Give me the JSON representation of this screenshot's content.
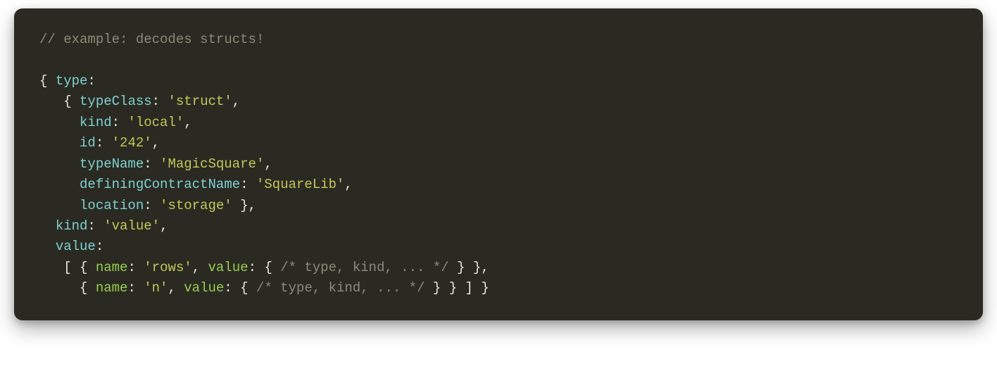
{
  "code": {
    "comment_line": "// example: decodes structs!",
    "keys": {
      "type": "type",
      "typeClass": "typeClass",
      "kind": "kind",
      "id": "id",
      "typeName": "typeName",
      "definingContractName": "definingContractName",
      "location": "location",
      "value": "value",
      "name": "name"
    },
    "strings": {
      "struct": "'struct'",
      "local": "'local'",
      "id242": "'242'",
      "magicSquare": "'MagicSquare'",
      "squareLib": "'SquareLib'",
      "storage": "'storage'",
      "valueKind": "'value'",
      "rows": "'rows'",
      "n": "'n'"
    },
    "block_comment": "/* type, kind, ... */",
    "punct": {
      "open_brace": "{",
      "close_brace": "}",
      "open_bracket": "[",
      "close_bracket": "]",
      "colon": ":",
      "comma": ",",
      "space": " "
    }
  }
}
